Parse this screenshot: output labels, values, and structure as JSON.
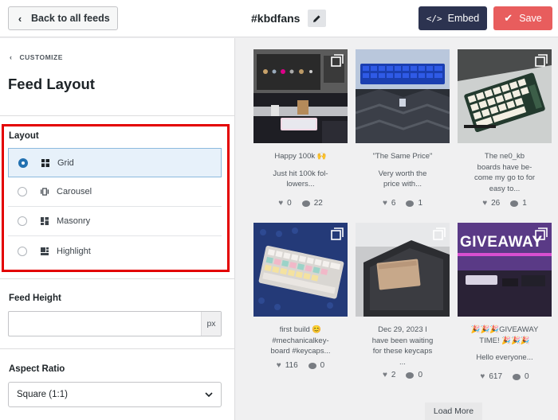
{
  "header": {
    "back_label": "Back to all feeds",
    "feed_name": "#kbdfans",
    "embed_label": "Embed",
    "save_label": "Save"
  },
  "sidebar": {
    "breadcrumb": "CUSTOMIZE",
    "title": "Feed Layout",
    "layout_label": "Layout",
    "layout_options": [
      {
        "label": "Grid",
        "selected": true
      },
      {
        "label": "Carousel",
        "selected": false
      },
      {
        "label": "Masonry",
        "selected": false
      },
      {
        "label": "Highlight",
        "selected": false
      }
    ],
    "feed_height_label": "Feed Height",
    "feed_height_value": "",
    "feed_height_unit": "px",
    "aspect_ratio_label": "Aspect Ratio",
    "aspect_ratio_value": "Square (1:1)"
  },
  "feed": {
    "posts": [
      {
        "caption1": "Happy 100k 🙌",
        "caption2": "Just hit 100k fol-",
        "caption3": "lowers...",
        "likes": "0",
        "comments": "22"
      },
      {
        "caption1": "\"The Same Price\"",
        "caption2": "Very worth the",
        "caption3": "price with...",
        "likes": "6",
        "comments": "1"
      },
      {
        "caption1": "The ne0_kb",
        "caption2": "boards have be-",
        "caption3": "come my go to for",
        "caption4": "easy to...",
        "likes": "26",
        "comments": "1"
      },
      {
        "caption1": "first build 😊",
        "caption2": "#mechanicalkey-",
        "caption3": "board #keycaps...",
        "likes": "116",
        "comments": "0"
      },
      {
        "caption1": "Dec 29, 2023 I",
        "caption2": "have been waiting",
        "caption3": "for these keycaps",
        "caption4": "...",
        "likes": "2",
        "comments": "0"
      },
      {
        "caption1": "🎉🎉🎉GIVEAWAY",
        "caption2": "TIME! 🎉🎉🎉",
        "caption3": "Hello everyone...",
        "likes": "617",
        "comments": "0"
      }
    ],
    "giveaway_text": "GIVEAWAY",
    "load_more_label": "Load More"
  },
  "colors": {
    "accent": "#2271b1",
    "embed_bg": "#2c3350",
    "save_bg": "#e85d5d",
    "highlight_border": "#e30000"
  }
}
